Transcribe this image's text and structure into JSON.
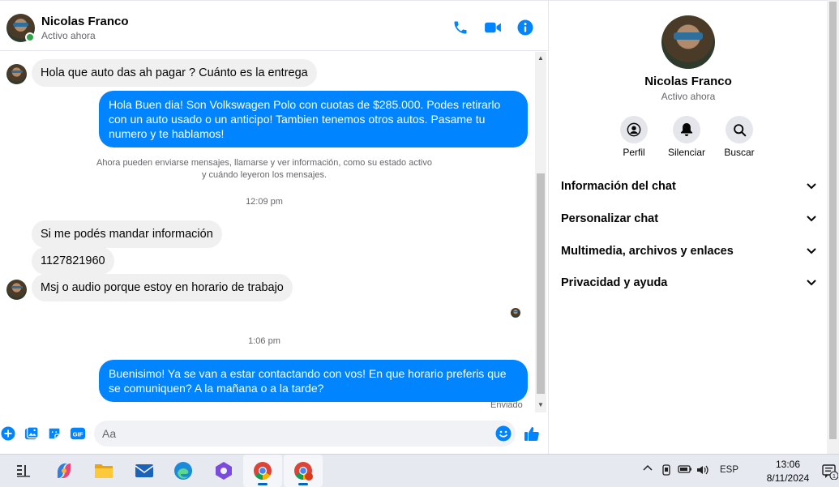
{
  "header": {
    "name": "Nicolas Franco",
    "status": "Activo ahora",
    "call_icon": "phone-icon",
    "video_icon": "video-camera-icon",
    "info_icon": "info-icon"
  },
  "messages": {
    "m1": "Hola que auto das ah pagar ? Cuánto es la entrega",
    "m2": "Hola Buen dia! Son Volkswagen Polo con cuotas de $285.000. Podes retirarlo con un auto usado o un anticipo! Tambien tenemos otros autos. Pasame tu numero y te hablamos!",
    "system_line1": "Ahora pueden enviarse mensajes, llamarse y ver información, como su estado activo",
    "system_line2": "y cuándo leyeron los mensajes.",
    "time1": "12:09 pm",
    "m3": "Si me podés mandar información",
    "m4": "1127821960",
    "m5": "Msj o audio porque estoy en horario de trabajo",
    "time2": "1:06 pm",
    "m6": "Buenisimo! Ya se van a estar contactando con vos! En que horario preferis que se comuniquen? A la mañana o a la tarde?",
    "sent_label": "Enviado"
  },
  "composer": {
    "placeholder": "Aa",
    "icons": [
      "plus-icon",
      "image-icon",
      "sticker-icon",
      "gif-icon",
      "emoji-icon",
      "like-icon"
    ],
    "gif_label": "GIF"
  },
  "info_panel": {
    "name": "Nicolas Franco",
    "status": "Activo ahora",
    "actions": [
      {
        "label": "Perfil",
        "icon": "profile-icon"
      },
      {
        "label": "Silenciar",
        "icon": "bell-icon"
      },
      {
        "label": "Buscar",
        "icon": "search-icon"
      }
    ],
    "sections": [
      "Información del chat",
      "Personalizar chat",
      "Multimedia, archivos y enlaces",
      "Privacidad y ayuda"
    ]
  },
  "taskbar": {
    "apps": [
      "widgets-icon",
      "copilot-icon",
      "file-explorer-icon",
      "mail-icon",
      "edge-icon",
      "clipchamp-icon",
      "chrome-icon",
      "chrome-profile-icon"
    ],
    "language": "ESP",
    "time": "13:06",
    "date": "8/11/2024",
    "notification_count": "1",
    "accent": "#0067c0"
  },
  "colors": {
    "messenger_blue": "#0084ff",
    "incoming_bubble": "#f0f0f0",
    "online_green": "#31a24c"
  }
}
